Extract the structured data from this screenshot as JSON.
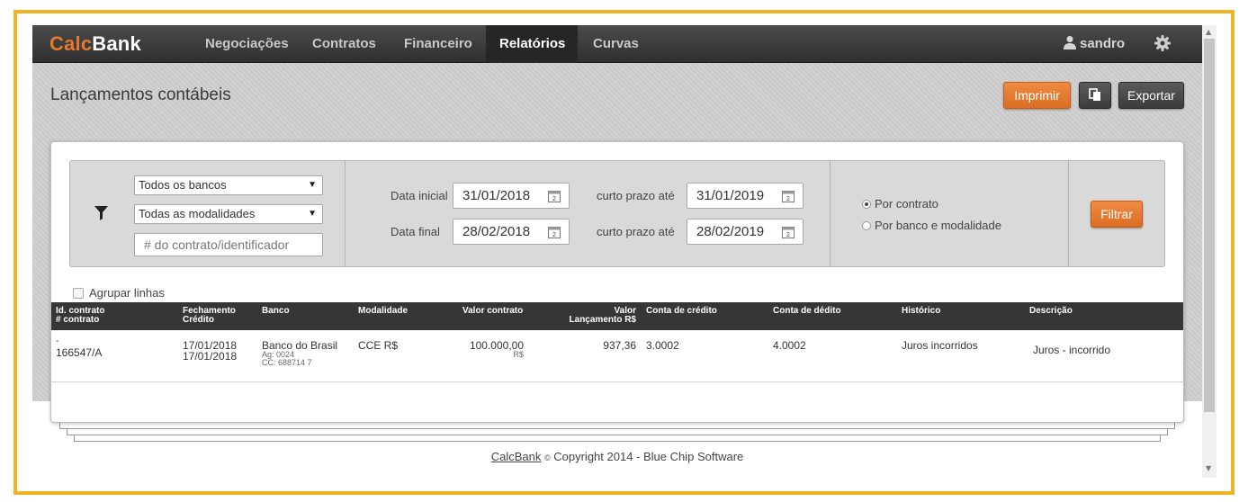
{
  "brand": {
    "part1": "Calc",
    "part2": "Bank"
  },
  "nav": {
    "items": [
      "Negociações",
      "Contratos",
      "Financeiro",
      "Relatórios",
      "Curvas"
    ],
    "active": "Relatórios",
    "user": "sandro",
    "icons": [
      "user-icon",
      "gear-icon"
    ]
  },
  "page": {
    "title": "Lançamentos contábeis"
  },
  "actions": {
    "print": "Imprimir",
    "export": "Exportar",
    "copy_icon": "copy-icon"
  },
  "filters": {
    "bank_select": "Todos os bancos",
    "modality_select": "Todas as modalidades",
    "contract_placeholder": "# do contrato/identificador",
    "start_label": "Data inicial",
    "start_value": "31/01/2018",
    "end_label": "Data final",
    "end_value": "28/02/2018",
    "short_term_label": "curto prazo até",
    "short_term_start": "31/01/2019",
    "short_term_end": "28/02/2019",
    "group_by_options": [
      "Por contrato",
      "Por banco e modalidade"
    ],
    "group_by_selected": "Por contrato",
    "filter_button": "Filtrar"
  },
  "group_lines": {
    "label": "Agrupar linhas",
    "checked": false
  },
  "table": {
    "headers": {
      "id_l1": "Id. contrato",
      "id_l2": "# contrato",
      "close_l1": "Fechamento",
      "close_l2": "Crédito",
      "bank": "Banco",
      "modality": "Modalidade",
      "contract_value": "Valor contrato",
      "entry_l1": "Valor",
      "entry_l2": "Lançamento R$",
      "credit_account": "Conta de crédito",
      "debit_account": "Conta de dédito",
      "history": "Histórico",
      "description": "Descrição"
    },
    "rows": [
      {
        "id": "-",
        "contract": "166547/A",
        "closing": "17/01/2018",
        "credit_date": "17/01/2018",
        "bank": "Banco do Brasil",
        "agency": "Ag: 0024",
        "account": "CC: 688714 7",
        "modality": "CCE R$",
        "contract_value": "100.000,00",
        "currency": "R$",
        "entry_value": "937,36",
        "credit_account": "3.0002",
        "debit_account": "4.0002",
        "history": "Juros incorridos",
        "description": "Juros - incorrido"
      }
    ]
  },
  "footer": {
    "link": "CalcBank",
    "copy_symbol": "©",
    "text": "Copyright 2014 - Blue Chip Software"
  },
  "colors": {
    "accent": "#e8792b",
    "navbar": "#3a3a3a",
    "frame": "#f0b322"
  }
}
